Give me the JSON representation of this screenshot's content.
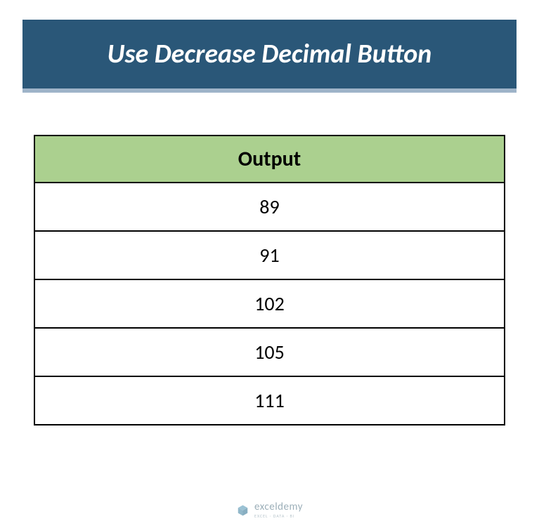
{
  "title": "Use Decrease Decimal Button",
  "table": {
    "header": "Output",
    "rows": [
      "89",
      "91",
      "102",
      "105",
      "111"
    ]
  },
  "watermark": {
    "main": "exceldemy",
    "sub": "EXCEL · DATA · BI"
  },
  "chart_data": {
    "type": "table",
    "title": "Output",
    "categories": [
      "Output"
    ],
    "values": [
      89,
      91,
      102,
      105,
      111
    ]
  }
}
